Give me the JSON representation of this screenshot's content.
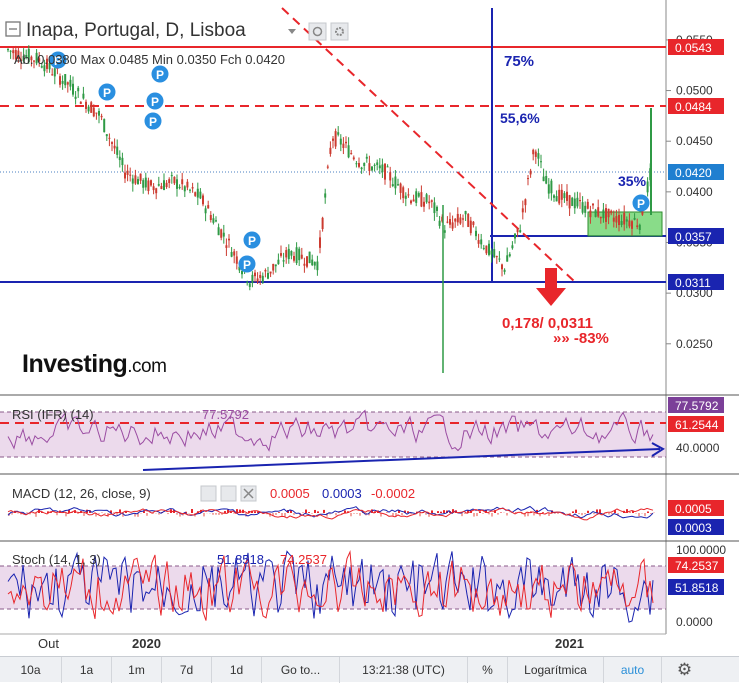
{
  "header": {
    "title": "Inapa, Portugal, D, Lisboa",
    "ohlc_line": "Ab. 0.0380  Max 0.0485  Min 0.0350  Fch 0.0420"
  },
  "logo": {
    "name": "Investing",
    "suffix": ".com"
  },
  "annotations": {
    "pct75": "75%",
    "pct556": "55,6%",
    "pct35": "35%",
    "target": "0,178/ 0,0311",
    "drop": "»» -83%",
    "pivot_marker": "P"
  },
  "price_axis": {
    "ticks": [
      "0.0550",
      "0.0500",
      "0.0450",
      "0.0400",
      "0.0350",
      "0.0300",
      "0.0250"
    ],
    "tags": [
      {
        "label": "0.0543",
        "color": "#e8262b"
      },
      {
        "label": "0.0484",
        "color": "#e8262b"
      },
      {
        "label": "0.0420",
        "color": "#1f7fd0"
      },
      {
        "label": "0.0357",
        "color": "#1a24b0"
      },
      {
        "label": "0.0311",
        "color": "#1a24b0"
      }
    ]
  },
  "rsi": {
    "label": "RSI (IFR) (14)",
    "value": "77.5792",
    "tags": [
      {
        "label": "77.5792",
        "color": "#7b3f98"
      },
      {
        "label": "61.2544",
        "color": "#e8262b"
      }
    ],
    "tick": "40.0000"
  },
  "macd": {
    "label": "MACD (12, 26, close, 9)",
    "v1": "0.0005",
    "v2": "0.0003",
    "v3": "-0.0002",
    "tags": [
      {
        "label": "0.0005",
        "color": "#e8262b"
      },
      {
        "label": "0.0003",
        "color": "#1a24b0"
      }
    ]
  },
  "stoch": {
    "label": "Stoch (14, 1, 3)",
    "v1": "51.8518",
    "v2": "74.2537",
    "top_tick": "100.0000",
    "bottom_tick": "0.0000",
    "tags": [
      {
        "label": "74.2537",
        "color": "#e8262b"
      },
      {
        "label": "51.8518",
        "color": "#1a24b0"
      }
    ]
  },
  "x_axis": {
    "labels": [
      "Out",
      "2020",
      "2021"
    ]
  },
  "toolbar": {
    "items": [
      "10a",
      "1a",
      "1m",
      "7d",
      "1d",
      "Go to...",
      "13:21:38 (UTC)",
      "%",
      "Logarítmica",
      "auto"
    ],
    "settings_icon": "gear-icon"
  },
  "chart_data": {
    "type": "candlestick",
    "title": "Inapa, Portugal, D, Lisboa",
    "x_labels": [
      "Out",
      "2020",
      "2021"
    ],
    "ylim": [
      0.0215,
      0.0565
    ],
    "open": 0.038,
    "high": 0.0485,
    "low": 0.035,
    "close": 0.042,
    "horizontal_levels": [
      0.0543,
      0.0484,
      0.0357,
      0.0311
    ],
    "last_price": 0.042,
    "series": [
      {
        "name": "RSI (IFR) (14)",
        "last": 77.5792,
        "reference": 61.2544
      },
      {
        "name": "MACD (12, 26, close, 9)",
        "macd": 0.0005,
        "signal": 0.0003,
        "histogram": -0.0002
      },
      {
        "name": "Stoch (14, 1, 3)",
        "k": 51.8518,
        "d": 74.2537
      }
    ]
  }
}
